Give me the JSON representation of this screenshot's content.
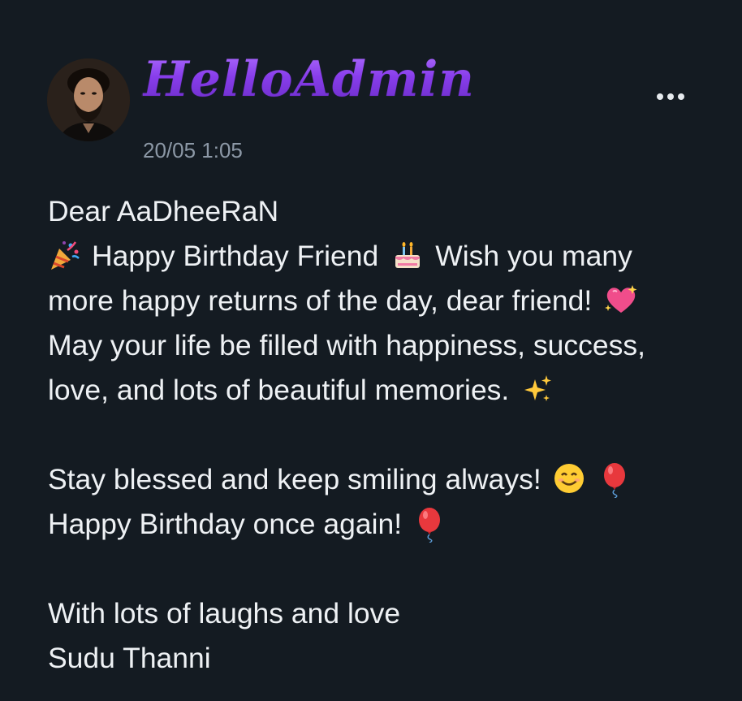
{
  "post": {
    "username": "HelloAdmin",
    "timestamp": "20/05 1:05",
    "more_icon": "more-horizontal-icon",
    "message": {
      "greeting": "Dear AaDheeRaN",
      "line2_text": "Happy Birthday Friend",
      "line2_tail": "Wish you many",
      "line3": "more happy returns of the day, dear friend!",
      "line4": "May your life be filled with happiness, success,",
      "line5": "love, and lots of beautiful memories.",
      "line6": "Stay blessed and keep smiling always!",
      "line7": "Happy Birthday once again!",
      "line8": "With lots of laughs and love",
      "signature": "Sudu Thanni"
    },
    "emojis": [
      "party-popper-icon",
      "birthday-cake-icon",
      "sparkling-heart-icon",
      "sparkles-icon",
      "smiling-face-icon",
      "balloon-icon",
      "balloon-icon"
    ]
  },
  "colors": {
    "background": "#141b22",
    "text": "#eef1f4",
    "timestamp": "#8c98a6",
    "username_accent": "#7b2fe0"
  }
}
